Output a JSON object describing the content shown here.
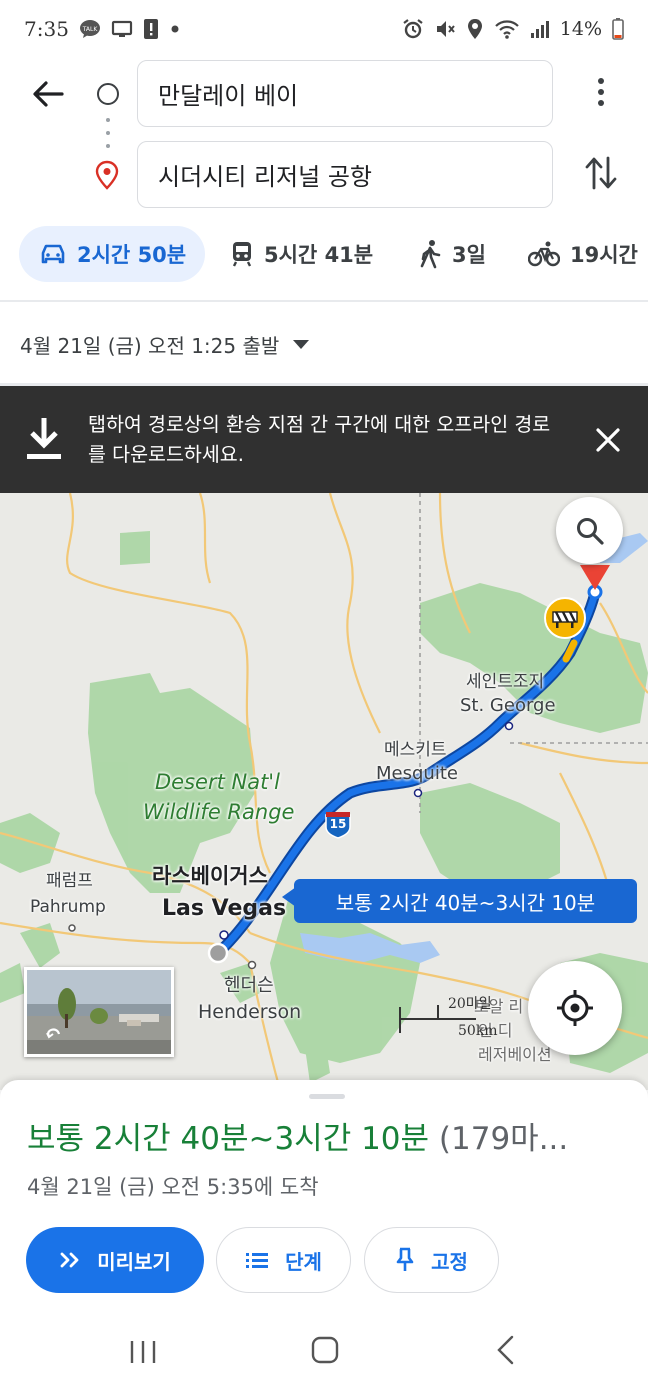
{
  "status_bar": {
    "time": "7:35",
    "battery_text": "14%",
    "left_icons": [
      "talk-icon",
      "monitor-icon",
      "alert-icon",
      "dot-icon"
    ],
    "right_icons": [
      "alarm-icon",
      "mute-icon",
      "location-icon",
      "wifi-icon",
      "signal-icon",
      "battery-icon"
    ]
  },
  "directions": {
    "origin": "만달레이 베이",
    "destination": "시더시티 리저널 공항"
  },
  "modes": [
    {
      "name": "drive",
      "icon": "car-icon",
      "label": "2시간 50분",
      "selected": true
    },
    {
      "name": "transit",
      "icon": "train-icon",
      "label": "5시간 41분",
      "selected": false
    },
    {
      "name": "walk",
      "icon": "walk-icon",
      "label": "3일",
      "selected": false
    },
    {
      "name": "bike",
      "icon": "bike-icon",
      "label": "19시간",
      "selected": false
    }
  ],
  "depart": "4월 21일 (금) 오전 1:25 출발",
  "banner": {
    "text": "탭하여 경로상의 환승 지점 간 구간에 대한 오프라인 경로를 다운로드하세요."
  },
  "map": {
    "labels": {
      "pahrump_ko": "패럼프",
      "pahrump_en": "Pahrump",
      "las_vegas_ko": "라스베이거스",
      "las_vegas_en": "Las Vegas",
      "henderson_ko": "헨더슨",
      "henderson_en": "Henderson",
      "mesquite_ko": "메스키트",
      "mesquite_en": "Mesquite",
      "st_george_ko": "세인트조지",
      "st_george_en": "St. George",
      "desert_line1": "Desert Nat'l",
      "desert_line2": "Wildlife Range",
      "lake_line1": "로알 리",
      "lake_line2": "인 디",
      "lake_line3": "레저베이션",
      "highway": "15"
    },
    "route_callout": "보통 2시간 40분~3시간 10분",
    "scale_miles": "20마일",
    "scale_km": "50km",
    "colors": {
      "route": "#1a73e8",
      "park": "#a8d5a2",
      "land": "#eaeae6",
      "road": "#f2c877",
      "water": "#a9c9f2"
    }
  },
  "sheet": {
    "duration": "보통 2시간 40분~3시간 10분",
    "distance": "(179마...",
    "arrival": "4월 21일 (금) 오전 5:35에 도착",
    "buttons": {
      "preview": "미리보기",
      "steps": "단계",
      "pin": "고정"
    }
  }
}
